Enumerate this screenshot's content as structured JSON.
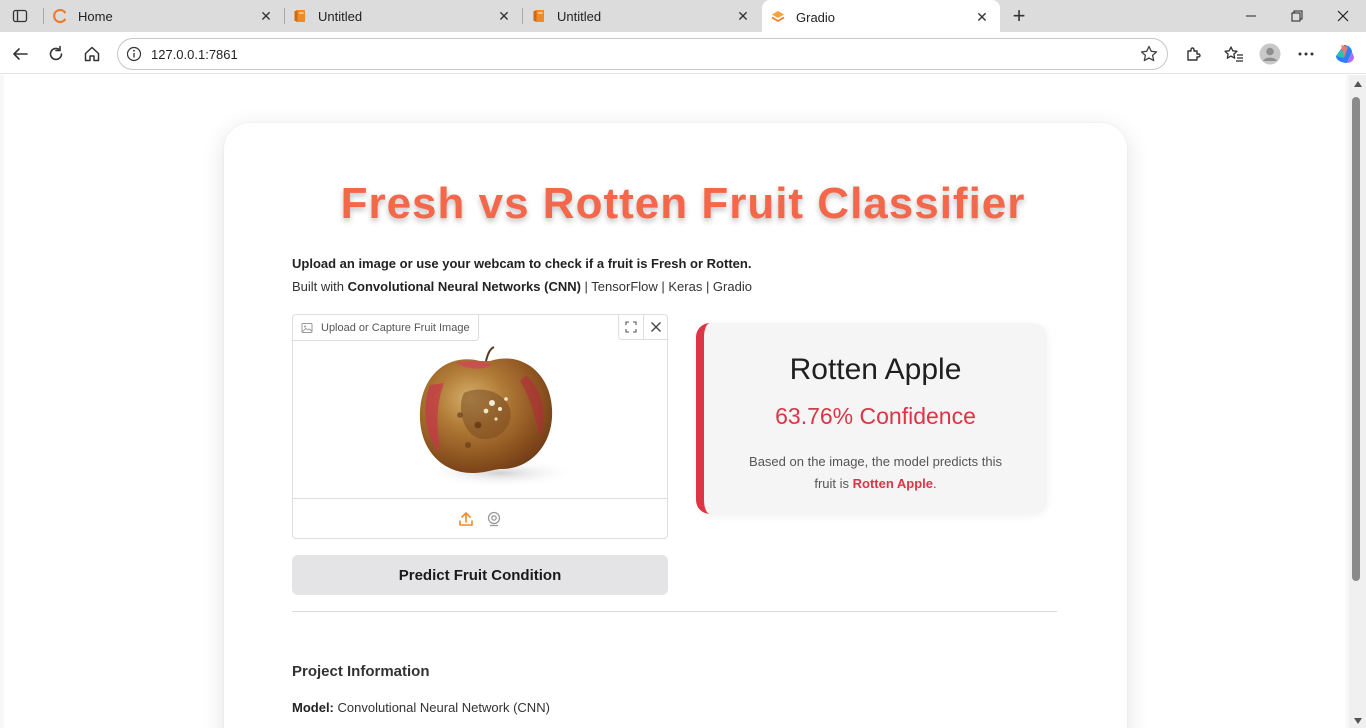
{
  "browser": {
    "tabs": [
      {
        "label": "Home",
        "favicon": "home-loader-icon",
        "active": false
      },
      {
        "label": "Untitled",
        "favicon": "notebook-icon",
        "active": false
      },
      {
        "label": "Untitled",
        "favicon": "notebook-icon",
        "active": false
      },
      {
        "label": "Gradio",
        "favicon": "gradio-icon",
        "active": true
      }
    ],
    "url": "127.0.0.1:7861"
  },
  "app": {
    "title": "Fresh vs Rotten Fruit Classifier",
    "description_line1": "Upload an image or use your webcam to check if a fruit is Fresh or Rotten.",
    "built_with_prefix": "Built with ",
    "built_with_bold": "Convolutional Neural Networks (CNN)",
    "built_with_suffix": " | TensorFlow | Keras | Gradio",
    "upload_label": "Upload or Capture Fruit Image",
    "predict_button": "Predict Fruit Condition",
    "result": {
      "label": "Rotten Apple",
      "confidence": "63.76% Confidence",
      "confidence_value": 63.76,
      "explanation_prefix": "Based on the image, the model predicts this fruit is ",
      "explanation_highlight": "Rotten Apple",
      "explanation_suffix": "."
    },
    "project_info": {
      "heading": "Project Information",
      "model_label": "Model:",
      "model_value": " Convolutional Neural Network (CNN)"
    }
  },
  "colors": {
    "title": "#f4674a",
    "rotten_accent": "#dc3545",
    "button_bg": "#e4e4e7",
    "upload_icon": "#f08a24"
  }
}
